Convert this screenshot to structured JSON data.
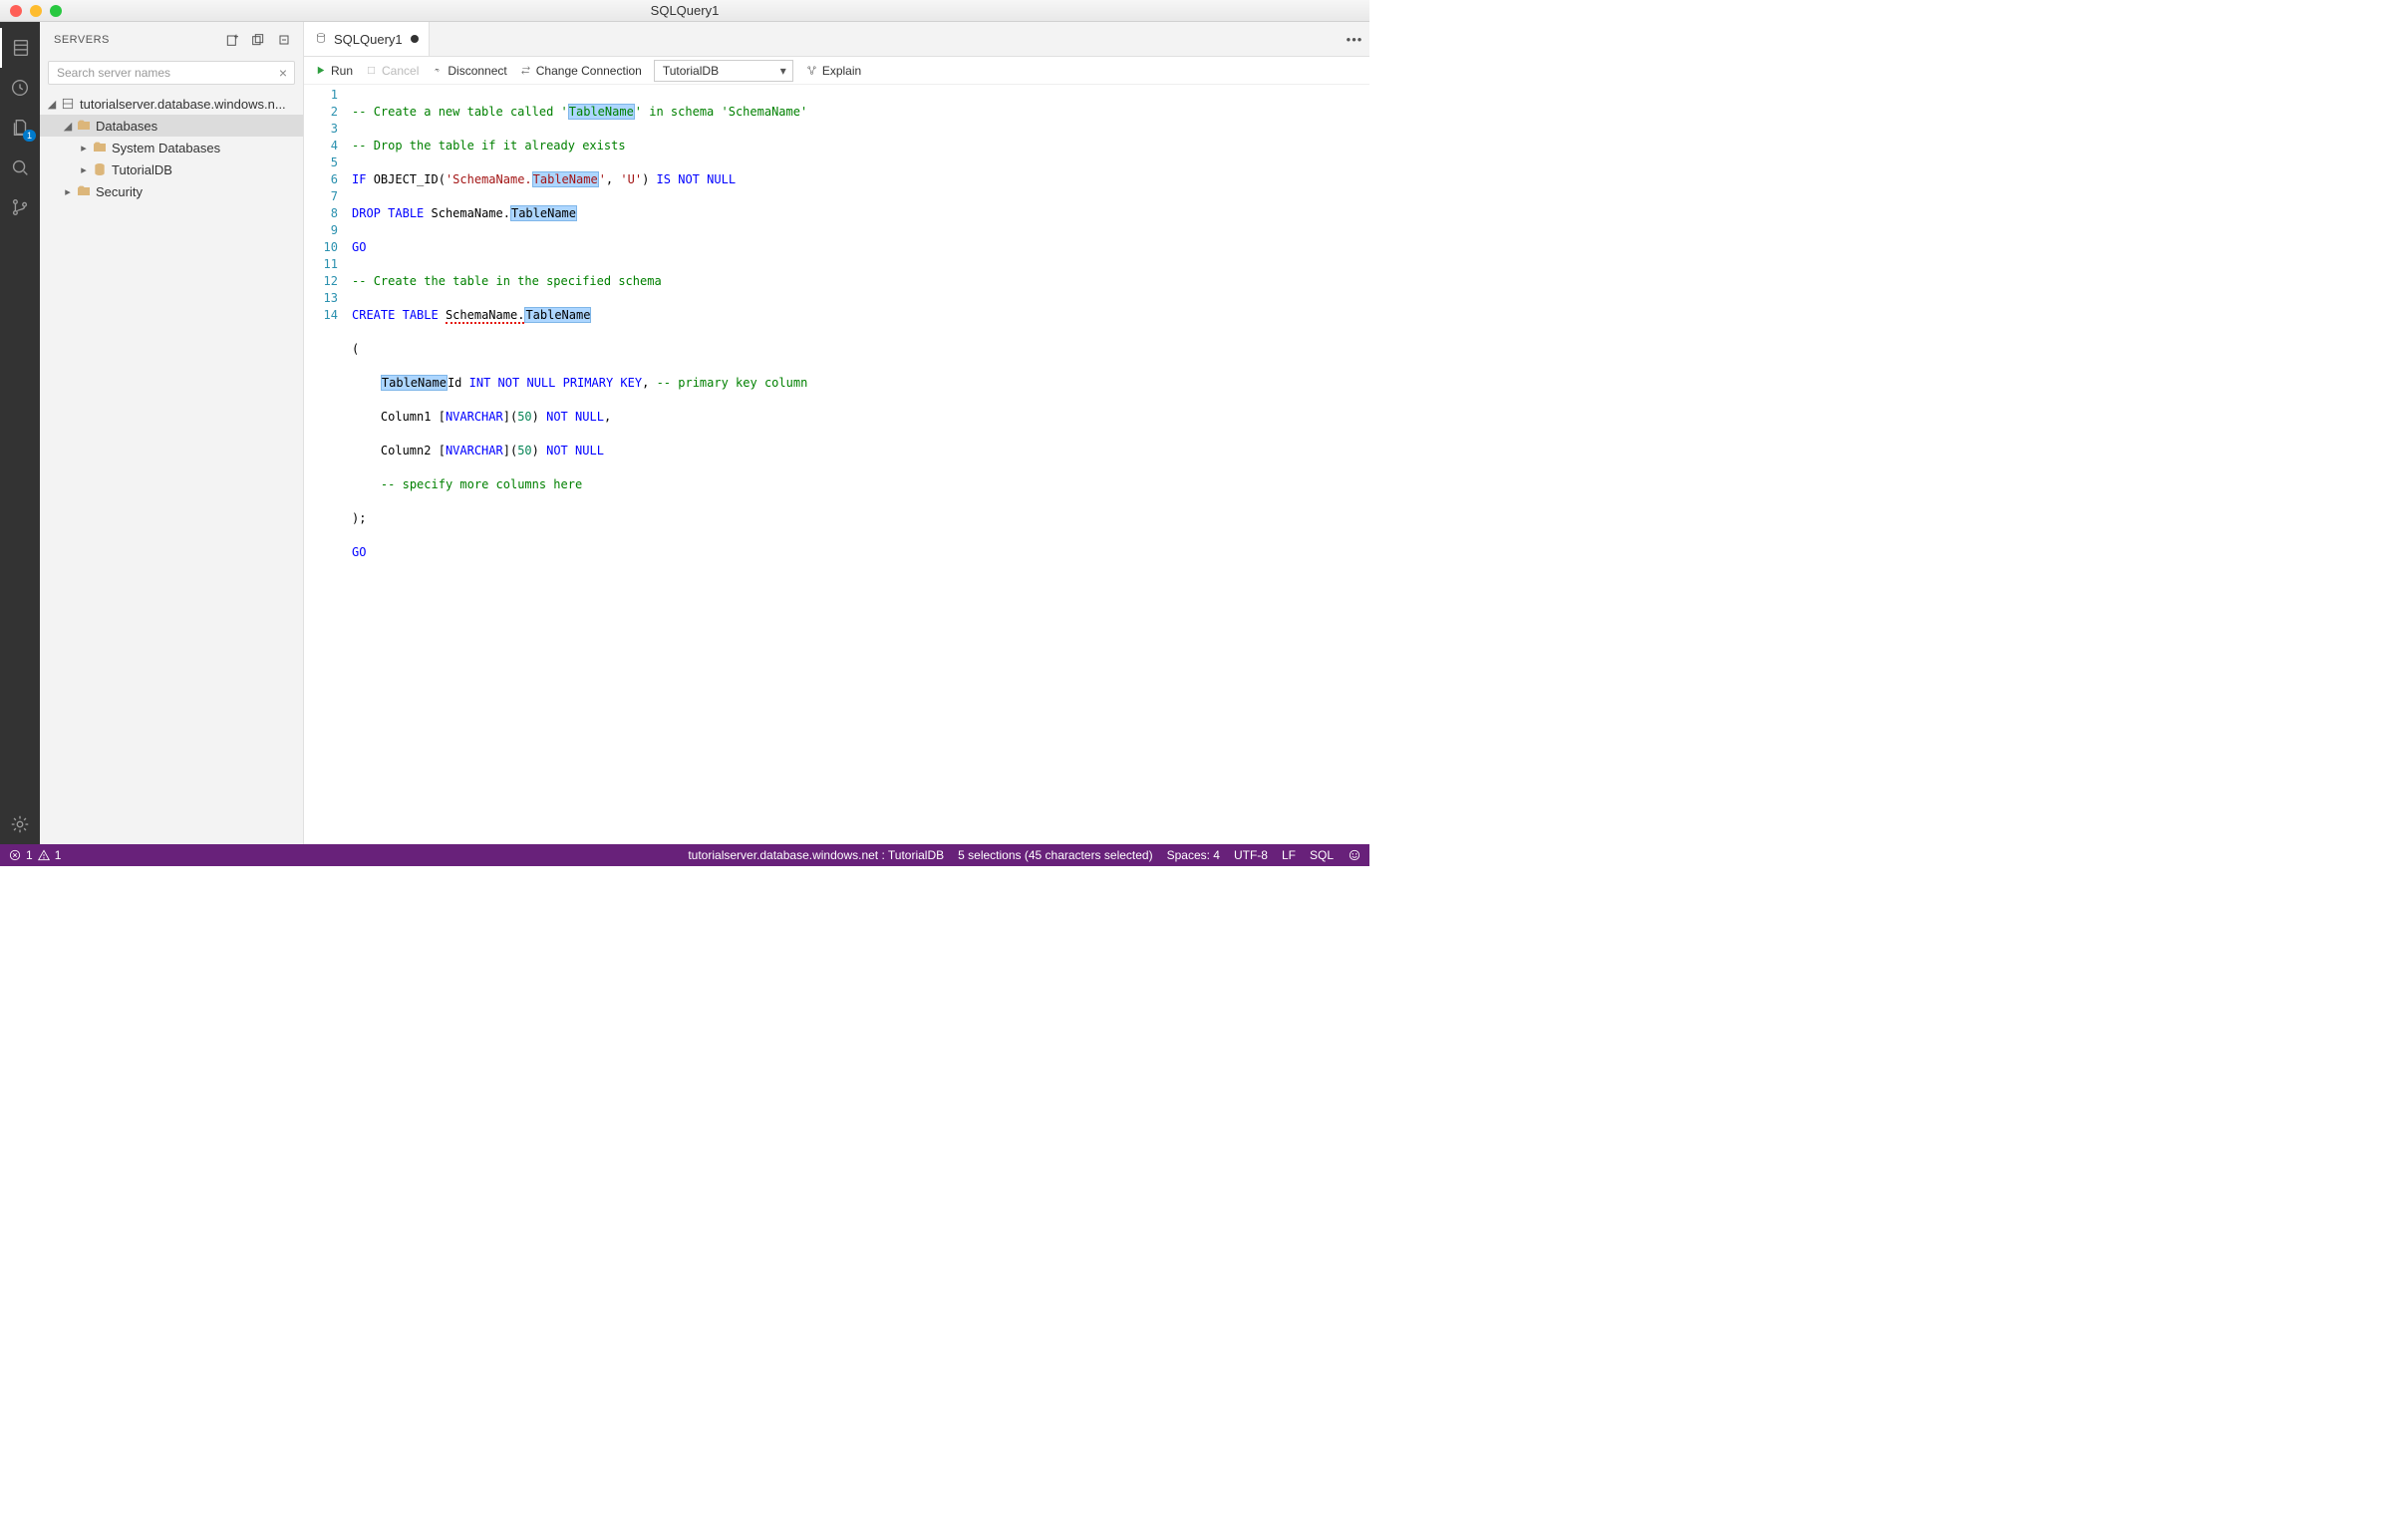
{
  "window": {
    "title": "SQLQuery1"
  },
  "activity": {
    "explorer_badge": "1"
  },
  "sidebar": {
    "header": "SERVERS",
    "search_placeholder": "Search server names",
    "tree": {
      "server": "tutorialserver.database.windows.n...",
      "databases": "Databases",
      "system_databases": "System Databases",
      "tutorialdb": "TutorialDB",
      "security": "Security"
    }
  },
  "tab": {
    "label": "SQLQuery1"
  },
  "toolbar": {
    "run": "Run",
    "cancel": "Cancel",
    "disconnect": "Disconnect",
    "change_connection": "Change Connection",
    "database": "TutorialDB",
    "explain": "Explain"
  },
  "code": {
    "lines": [
      {
        "n": 1,
        "raw": "comment1"
      },
      {
        "n": 2,
        "raw": "comment2"
      },
      {
        "n": 3,
        "raw": "if-line"
      },
      {
        "n": 4,
        "raw": "drop-line"
      },
      {
        "n": 5,
        "raw": "go1"
      },
      {
        "n": 6,
        "raw": "comment3"
      },
      {
        "n": 7,
        "raw": "create-line"
      },
      {
        "n": 8,
        "raw": "paren-open"
      },
      {
        "n": 9,
        "raw": "col-id"
      },
      {
        "n": 10,
        "raw": "col1"
      },
      {
        "n": 11,
        "raw": "col2"
      },
      {
        "n": 12,
        "raw": "comment4"
      },
      {
        "n": 13,
        "raw": "paren-close"
      },
      {
        "n": 14,
        "raw": "go2"
      }
    ],
    "tokens": {
      "comment_prefix": "-- ",
      "c1a": "Create a new table called '",
      "c1_hl": "TableName",
      "c1b": "' in schema '",
      "c1c": "SchemaName",
      "c1d": "'",
      "c2": "Drop the table if it already exists",
      "if": "IF",
      "object_id": "OBJECT_ID",
      "lp": "(",
      "rp": ")",
      "str_schema": "'SchemaName.",
      "str_tn": "TableName",
      "str_close": "'",
      "comma": ", ",
      "str_u": "'U'",
      "is": "IS",
      "not": "NOT",
      "null": "NULL",
      "drop": "DROP",
      "table": "TABLE",
      "schemadot": "SchemaName.",
      "tn_hl": "TableName",
      "go": "GO",
      "c3": "Create the table in the specified schema",
      "create": "CREATE",
      "tnid": "TableName",
      "id": "Id ",
      "int": "INT",
      "primary": "PRIMARY",
      "key": "KEY",
      "c_pk": "primary key column",
      "column1": "Column1 ",
      "column2": "Column2 ",
      "lbr": "[",
      "nvarchar": "NVARCHAR",
      "rbr": "]",
      "fifty": "50",
      "c4": "specify more columns here",
      "semiclose": ");",
      "indent": "    "
    }
  },
  "status": {
    "errors": "1",
    "warnings": "1",
    "connection": "tutorialserver.database.windows.net : TutorialDB",
    "selections": "5 selections (45 characters selected)",
    "spaces": "Spaces: 4",
    "encoding": "UTF-8",
    "eol": "LF",
    "lang": "SQL"
  }
}
